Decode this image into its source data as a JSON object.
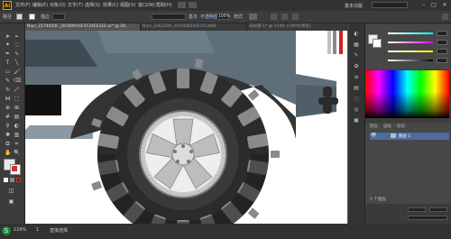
{
  "app": {
    "logo_text": "Ai",
    "workspace": "基本功能"
  },
  "menu": [
    "文件(F)",
    "编辑(E)",
    "对象(O)",
    "文字(T)",
    "选择(S)",
    "效果(C)",
    "视图(V)",
    "窗口(W)",
    "帮助(H)"
  ],
  "control_bar": {
    "label": "路径",
    "stroke_label": "描边",
    "style_label": "样式",
    "opacity_label": "不透明度",
    "opacity_value": "100%",
    "style_value": "基本"
  },
  "tabs": [
    {
      "label": "Nips_2174050F_20180916E5F24EE31E.ai* @ 28...",
      "active": true
    },
    {
      "label": "Nips_2262199_201808D16E31C4B8...",
      "active": false
    },
    {
      "label": "未标题-1* @ 124% (CMYK/预览)",
      "active": false
    }
  ],
  "canvas": {
    "background": "#ffffff",
    "body_color": "#5e6f79",
    "tire_color": "#2b2b2b",
    "tread_color": "#8a8a8a",
    "rim_color": "#d8d8d8"
  },
  "panels": {
    "layers_tabs": [
      "图层",
      "画板",
      "链接"
    ],
    "layer_name": "图层 1",
    "layer_count": "1 个图层"
  },
  "status": {
    "zoom": "124%",
    "page": "1",
    "tool": "直接选择"
  }
}
